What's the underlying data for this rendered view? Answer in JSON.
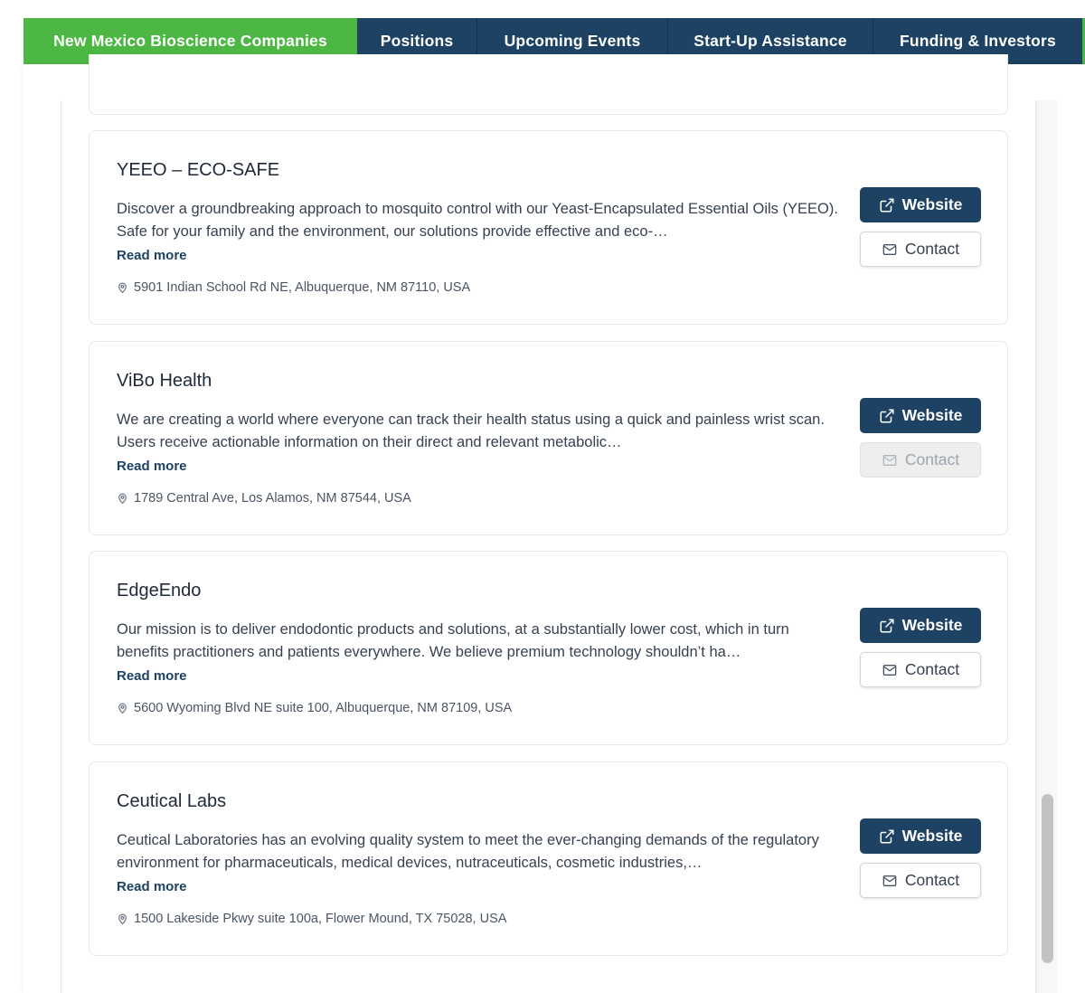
{
  "nav": {
    "items": [
      {
        "label": "New Mexico Bioscience Companies",
        "active": true
      },
      {
        "label": "Positions",
        "active": false
      },
      {
        "label": "Upcoming Events",
        "active": false
      },
      {
        "label": "Start-Up Assistance",
        "active": false
      },
      {
        "label": "Funding & Investors",
        "active": false
      }
    ]
  },
  "colors": {
    "nav_bg": "#1d4264",
    "nav_active": "#4cb843",
    "button_primary": "#1d4264"
  },
  "companies": [
    {
      "name": "YEEO – ECO-SAFE",
      "description": "Discover a groundbreaking approach to mosquito control with our Yeast-Encapsulated Essential Oils (YEEO). Safe for your family and the environment, our solutions provide effective and eco-…",
      "read_more": "Read more",
      "address": "5901 Indian School Rd NE, Albuquerque, NM 87110, USA",
      "website_label": "Website",
      "contact_label": "Contact",
      "contact_enabled": true
    },
    {
      "name": "ViBo Health",
      "description": "We are creating a world where everyone can track their health status using a quick and painless wrist scan. Users receive actionable information on their direct and relevant metabolic…",
      "read_more": "Read more",
      "address": "1789 Central Ave, Los Alamos, NM 87544, USA",
      "website_label": "Website",
      "contact_label": "Contact",
      "contact_enabled": false
    },
    {
      "name": "EdgeEndo",
      "description": "Our mission is to deliver endodontic products and solutions, at a substantially lower cost, which in turn benefits practitioners and patients everywhere. We believe premium technology shouldn’t ha…",
      "read_more": "Read more",
      "address": "5600 Wyoming Blvd NE suite 100, Albuquerque, NM 87109, USA",
      "website_label": "Website",
      "contact_label": "Contact",
      "contact_enabled": true
    },
    {
      "name": "Ceutical Labs",
      "description": "Ceutical Laboratories has an evolving quality system to meet the ever-changing demands of the regulatory environment for pharmaceuticals, medical devices, nutraceuticals, cosmetic industries,…",
      "read_more": "Read more",
      "address": "1500 Lakeside Pkwy suite 100a, Flower Mound, TX 75028, USA",
      "website_label": "Website",
      "contact_label": "Contact",
      "contact_enabled": true
    }
  ]
}
